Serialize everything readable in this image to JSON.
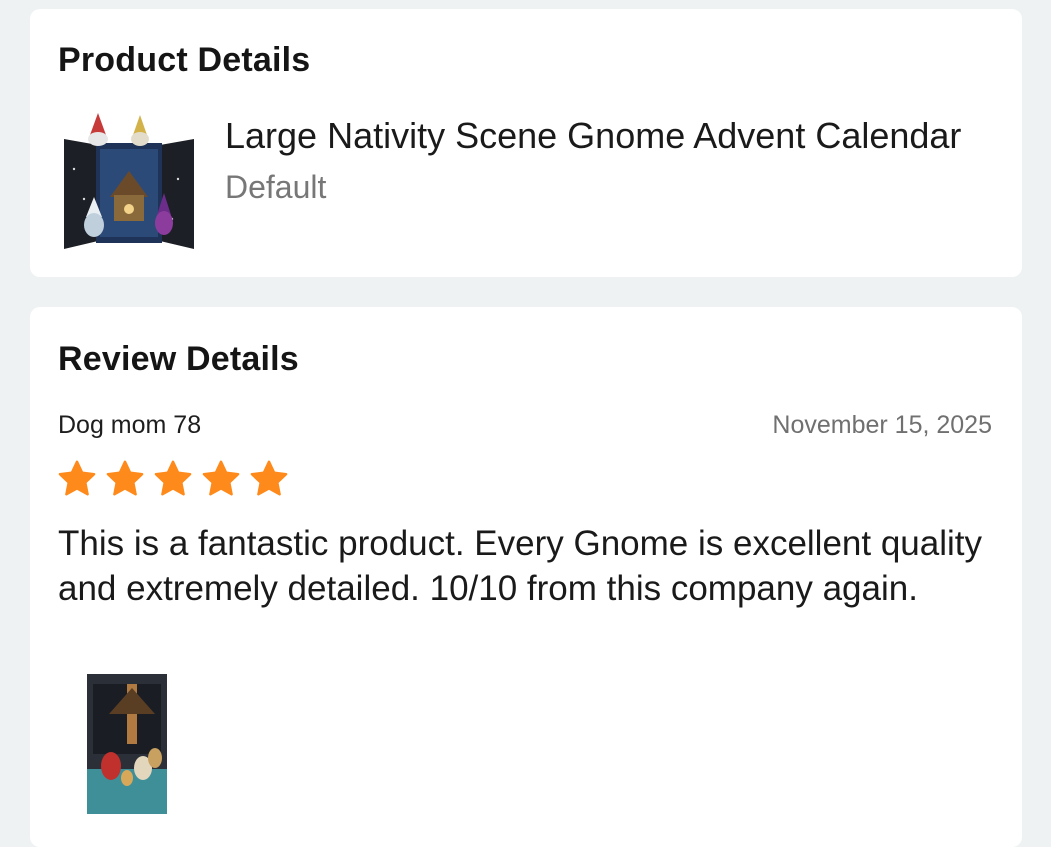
{
  "product_section": {
    "title": "Product Details",
    "product_name": "Large Nativity Scene Gnome Advent Calendar",
    "variant": "Default",
    "thumbnail_icon": "advent-calendar-image"
  },
  "review_section": {
    "title": "Review Details",
    "reviewer": "Dog mom 78",
    "date": "November 15, 2025",
    "rating": 5,
    "rating_max": 5,
    "text": "This is a fantastic product. Every Gnome is excellent quality and extremely detailed. 10/10 from this company again.",
    "photo_icon": "review-photo-image"
  },
  "colors": {
    "background": "#eef2f3",
    "card": "#ffffff",
    "star": "#fd8a1b",
    "muted_text": "#777777"
  }
}
